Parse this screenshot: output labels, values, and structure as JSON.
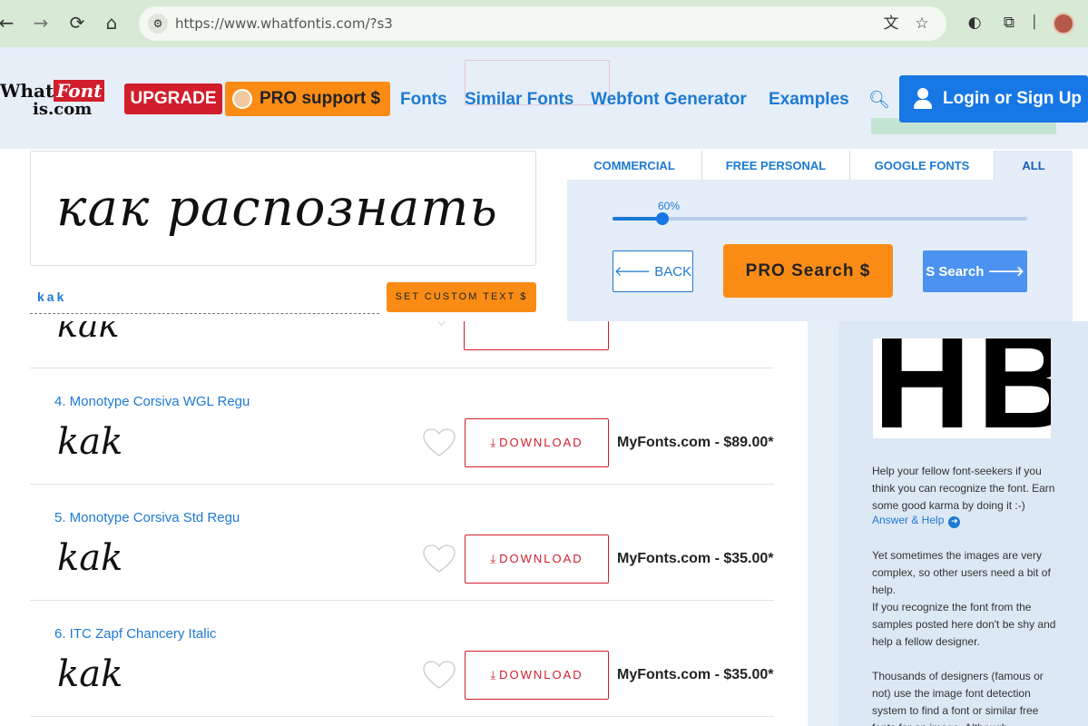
{
  "browser": {
    "url": "https://www.whatfontis.com/?s3",
    "colors": {
      "frame": "#d8e9d6",
      "urlbar": "#f4f8f2"
    }
  },
  "header": {
    "logo_what": "What",
    "logo_font": "Font",
    "logo_is": "is.com",
    "upgrade_label": "UPGRADE",
    "pro_support_label": "PRO support $",
    "nav": [
      "Fonts",
      "Similar Fonts",
      "Webfont Generator",
      "Examples"
    ],
    "login_label": "Login or Sign Up"
  },
  "preview": {
    "text": "как распознать",
    "custom_text_value": "kak",
    "custom_text_button": "SET CUSTOM TEXT $"
  },
  "filters": {
    "tabs": [
      "COMMERCIAL",
      "FREE PERSONAL",
      "GOOGLE FONTS",
      "ALL"
    ],
    "active_tab": "ALL",
    "similarity_label": "60%",
    "similarity_fraction": 0.12,
    "back_label": "BACK",
    "pro_search_label": "PRO Search $",
    "s_search_label": "S Search"
  },
  "results": {
    "partial_sample": "kak",
    "rows": [
      {
        "title": "4. Monotype Corsiva WGL Regu",
        "sample": "kak",
        "download_label": "DOWNLOAD",
        "price": "MyFonts.com - $89.00*"
      },
      {
        "title": "5. Monotype Corsiva Std Regu",
        "sample": "kak",
        "download_label": "DOWNLOAD",
        "price": "MyFonts.com - $35.00*"
      },
      {
        "title": "6. ITC Zapf Chancery Italic",
        "sample": "kak",
        "download_label": "DOWNLOAD",
        "price": "MyFonts.com - $35.00*"
      }
    ]
  },
  "sidebar": {
    "sample_image_text": "HB",
    "help_paragraph": "Help your fellow font-seekers if you think you can recognize the font. Earn some good karma by doing it :-)",
    "answer_link": "Answer & Help",
    "para2": "Yet sometimes the images are very complex, so other users need a bit of help.",
    "para3": "If you recognize the font from the samples posted here don't be shy and help a fellow designer.",
    "para4": "Thousands of designers (famous or not) use the image font detection system to find a font or similar free fonts for an image. Although"
  },
  "colors": {
    "brand_red": "#d11d2c",
    "brand_orange": "#fa8c16",
    "link_blue": "#1d7ad2",
    "button_blue": "#1777e5"
  }
}
